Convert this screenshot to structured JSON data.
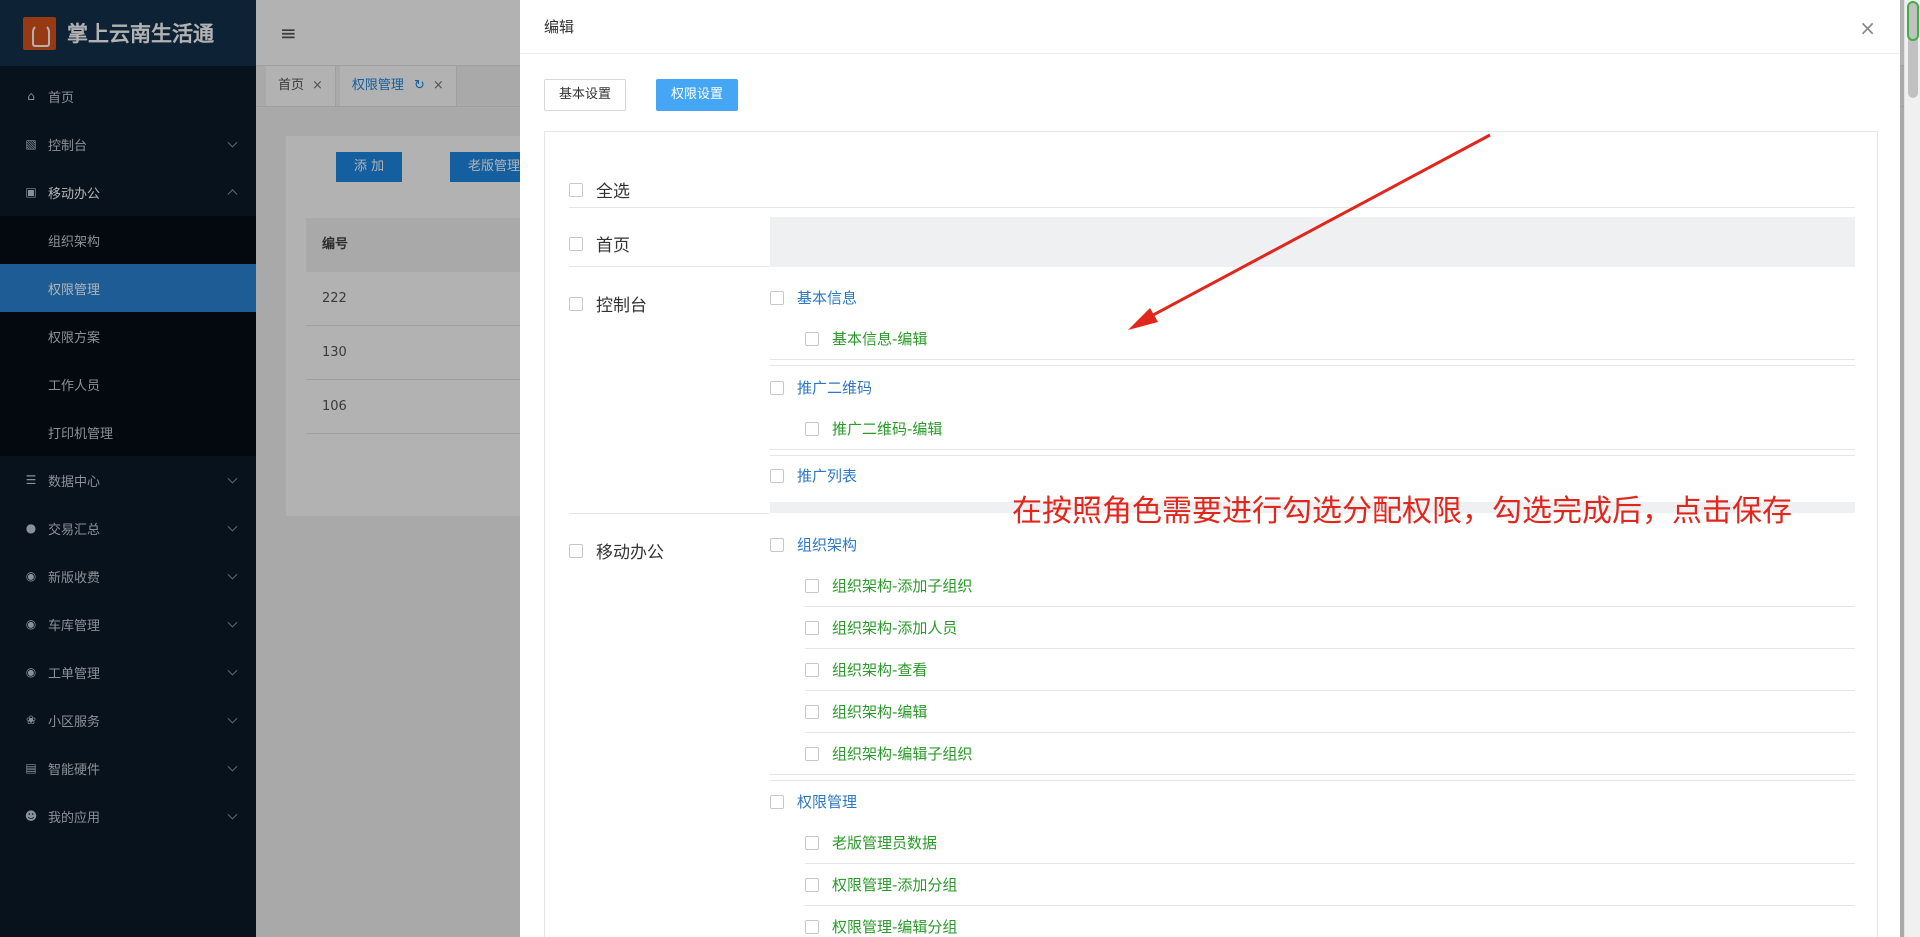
{
  "app": {
    "title": "掌上云南生活通"
  },
  "sidebar": {
    "items": [
      {
        "label": "首页",
        "icon": "home-icon",
        "expandable": false
      },
      {
        "label": "控制台",
        "icon": "monitor-icon",
        "expandable": true
      },
      {
        "label": "移动办公",
        "icon": "briefcase-icon",
        "expandable": true,
        "open": true
      },
      {
        "label": "数据中心",
        "icon": "database-icon",
        "expandable": true
      },
      {
        "label": "交易汇总",
        "icon": "moneybag-icon",
        "expandable": true
      },
      {
        "label": "新版收费",
        "icon": "chat-icon",
        "expandable": true
      },
      {
        "label": "车库管理",
        "icon": "chat-icon",
        "expandable": true
      },
      {
        "label": "工单管理",
        "icon": "chat-icon",
        "expandable": true
      },
      {
        "label": "小区服务",
        "icon": "service-icon",
        "expandable": true
      },
      {
        "label": "智能硬件",
        "icon": "hardware-icon",
        "expandable": true
      },
      {
        "label": "我的应用",
        "icon": "user-icon",
        "expandable": true
      }
    ],
    "submenu": [
      {
        "label": "组织架构"
      },
      {
        "label": "权限管理",
        "active": true
      },
      {
        "label": "权限方案"
      },
      {
        "label": "工作人员"
      },
      {
        "label": "打印机管理"
      }
    ]
  },
  "tabs": [
    {
      "label": "首页"
    },
    {
      "label": "权限管理",
      "active": true
    }
  ],
  "page": {
    "add_button": "添 加",
    "old_admin_button": "老版管理",
    "table_header": "编号",
    "rows": [
      "222",
      "130",
      "106"
    ]
  },
  "modal": {
    "title": "编辑",
    "tabs": [
      {
        "label": "基本设置"
      },
      {
        "label": "权限设置",
        "active": true
      }
    ],
    "select_all": "全选",
    "groups": {
      "home": {
        "label": "首页"
      },
      "console": {
        "label": "控制台",
        "children": [
          {
            "label": "基本信息",
            "children": [
              "基本信息-编辑"
            ]
          },
          {
            "label": "推广二维码",
            "children": [
              "推广二维码-编辑"
            ]
          },
          {
            "label": "推广列表",
            "children": []
          }
        ]
      },
      "mobile": {
        "label": "移动办公",
        "children": [
          {
            "label": "组织架构",
            "children": [
              "组织架构-添加子组织",
              "组织架构-添加人员",
              "组织架构-查看",
              "组织架构-编辑",
              "组织架构-编辑子组织"
            ]
          },
          {
            "label": "权限管理",
            "children": [
              "老版管理员数据",
              "权限管理-添加分组",
              "权限管理-编辑分组"
            ]
          }
        ]
      }
    }
  },
  "annotation": {
    "text": "在按照角色需要进行勾选分配权限，勾选完成后，点击保存"
  },
  "colors": {
    "sidebar_bg": "#0c1a29",
    "accent": "#1e88e5",
    "annotation": "#e1261c",
    "level2": "#2c78c5",
    "level3": "#2a9a2a"
  }
}
